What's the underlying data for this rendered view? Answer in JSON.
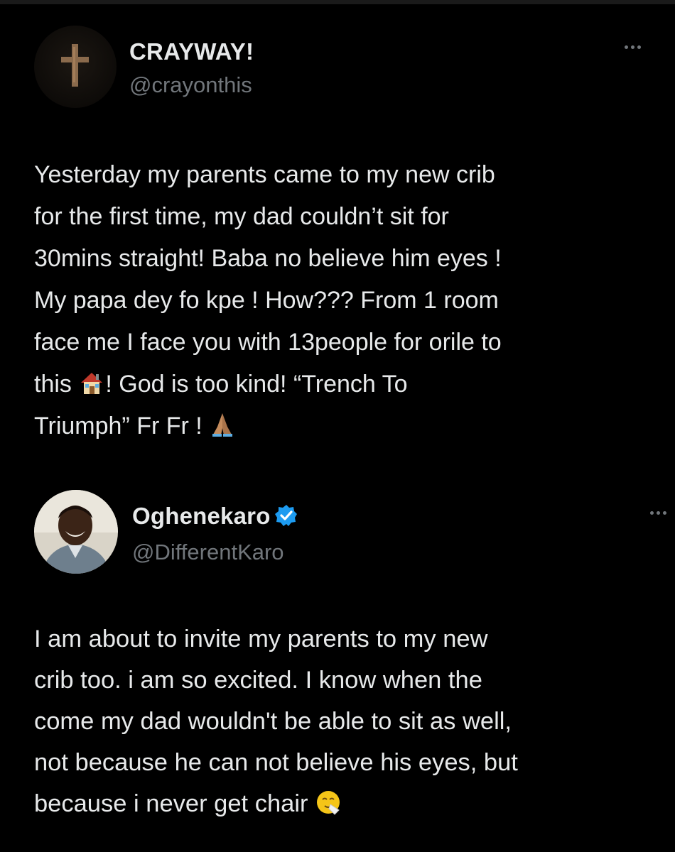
{
  "tweets": [
    {
      "name": "CRAYWAY!",
      "handle": "@crayonthis",
      "verified": false,
      "text_before_emoji1": "Yesterday my parents came to my new crib\nfor the first time, my dad couldn’t sit for\n30mins straight! Baba no believe him eyes !\nMy papa dey fo kpe ! How??? From 1 room\nface me I face you with 13people for orile to\nthis ",
      "emoji1": "house-emoji",
      "text_between": "! God is too kind! “Trench To\nTriumph” Fr Fr ! ",
      "emoji2": "folded-hands-emoji"
    },
    {
      "name": "Oghenekaro",
      "handle": "@DifferentKaro",
      "verified": true,
      "text_before_emoji": "I am about to invite my parents to my new\ncrib too. i am so excited. I know when the\ncome my dad wouldn't be able to sit as well,\nnot because he can not believe his eyes, but\nbecause i never get chair ",
      "emoji": "sneezing-face-emoji"
    }
  ]
}
